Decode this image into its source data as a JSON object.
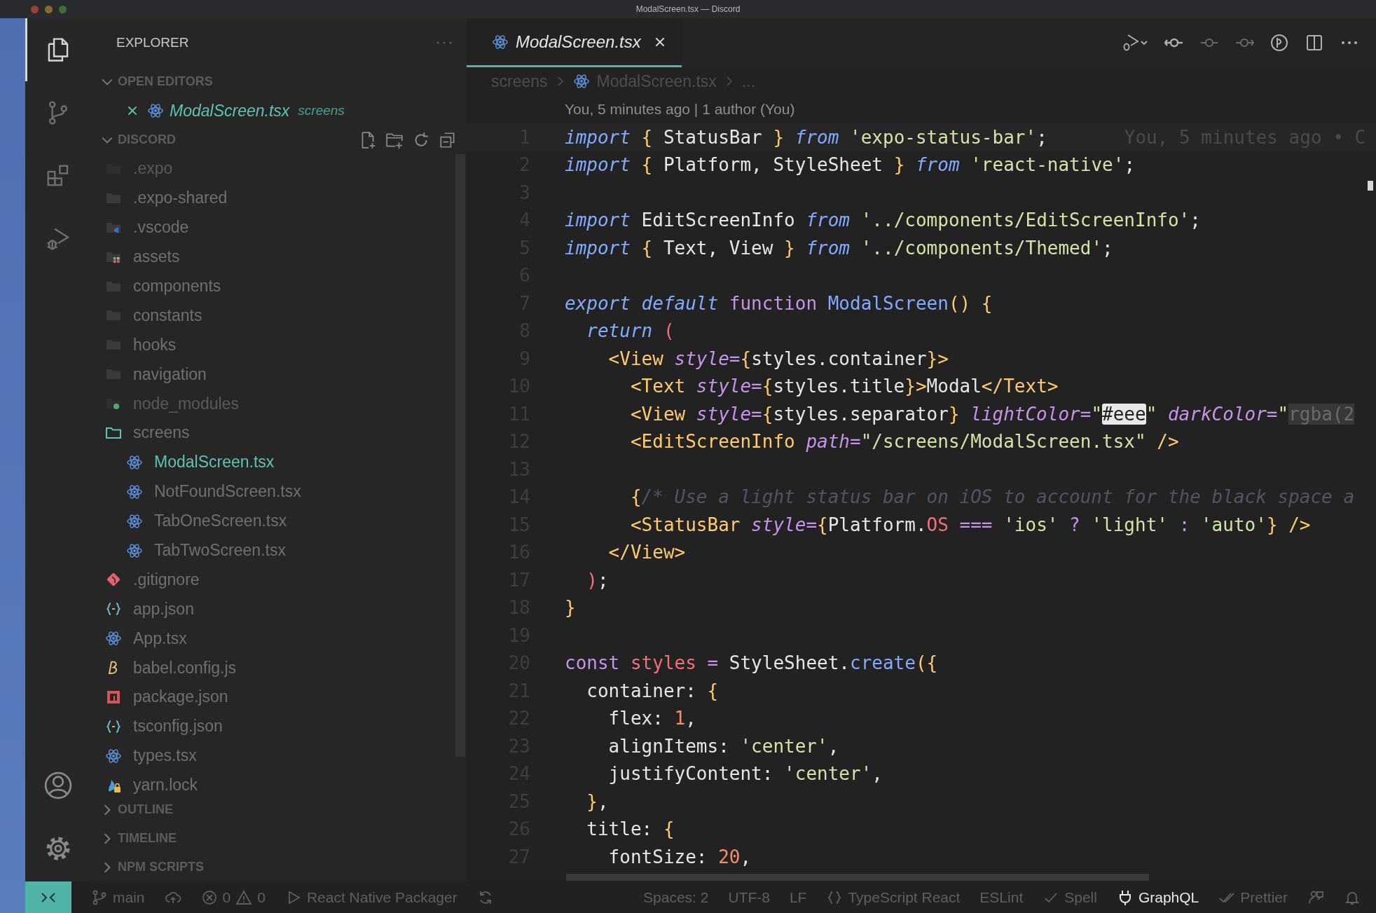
{
  "window": {
    "title": "ModalScreen.tsx — Discord"
  },
  "activity_bar": {
    "top": [
      {
        "kind": "explorer",
        "selected": true
      },
      {
        "kind": "source-control",
        "selected": false
      },
      {
        "kind": "extensions",
        "selected": false
      },
      {
        "kind": "run-debug",
        "selected": false
      }
    ],
    "bottom": [
      {
        "kind": "account"
      },
      {
        "kind": "settings"
      }
    ]
  },
  "sidebar": {
    "title": "EXPLORER",
    "sections": [
      {
        "title": "OPEN EDITORS",
        "expanded": true,
        "editors": [
          {
            "name": "ModalScreen.tsx",
            "folder": "screens",
            "kind": "react"
          }
        ]
      },
      {
        "title": "DISCORD",
        "expanded": true,
        "tree": [
          {
            "name": ".expo",
            "kind": "folder",
            "expanded": false,
            "dimmed": true,
            "selected": false
          },
          {
            "name": ".expo-shared",
            "kind": "folder",
            "expanded": false,
            "dimmed": false,
            "selected": false
          },
          {
            "name": ".vscode",
            "kind": "vscode-folder",
            "expanded": false,
            "dimmed": false,
            "selected": false
          },
          {
            "name": "assets",
            "kind": "assets-folder",
            "expanded": false,
            "dimmed": false,
            "selected": false
          },
          {
            "name": "components",
            "kind": "folder",
            "expanded": false,
            "dimmed": false,
            "selected": false
          },
          {
            "name": "constants",
            "kind": "folder",
            "expanded": false,
            "dimmed": false,
            "selected": false
          },
          {
            "name": "hooks",
            "kind": "folder",
            "expanded": false,
            "dimmed": false,
            "selected": false
          },
          {
            "name": "navigation",
            "kind": "folder",
            "expanded": false,
            "dimmed": false,
            "selected": false
          },
          {
            "name": "node_modules",
            "kind": "node-folder",
            "expanded": false,
            "dimmed": true,
            "selected": false
          },
          {
            "name": "screens",
            "kind": "folder",
            "expanded": true,
            "dimmed": false,
            "selected": false,
            "children": [
              {
                "name": "ModalScreen.tsx",
                "kind": "react",
                "dimmed": false,
                "selected": true
              },
              {
                "name": "NotFoundScreen.tsx",
                "kind": "react",
                "dimmed": false,
                "selected": false
              },
              {
                "name": "TabOneScreen.tsx",
                "kind": "react",
                "dimmed": false,
                "selected": false
              },
              {
                "name": "TabTwoScreen.tsx",
                "kind": "react",
                "dimmed": false,
                "selected": false
              }
            ]
          },
          {
            "name": ".gitignore",
            "kind": "git",
            "dimmed": false,
            "selected": false
          },
          {
            "name": "app.json",
            "kind": "json",
            "dimmed": false,
            "selected": false
          },
          {
            "name": "App.tsx",
            "kind": "react",
            "dimmed": false,
            "selected": false
          },
          {
            "name": "babel.config.js",
            "kind": "babel",
            "dimmed": false,
            "selected": false
          },
          {
            "name": "package.json",
            "kind": "npm",
            "dimmed": false,
            "selected": false
          },
          {
            "name": "tsconfig.json",
            "kind": "json",
            "dimmed": false,
            "selected": false
          },
          {
            "name": "types.tsx",
            "kind": "react",
            "dimmed": false,
            "selected": false
          },
          {
            "name": "yarn.lock",
            "kind": "yarn",
            "dimmed": false,
            "selected": false
          }
        ]
      },
      {
        "title": "OUTLINE",
        "expanded": false
      },
      {
        "title": "TIMELINE",
        "expanded": false
      },
      {
        "title": "NPM SCRIPTS",
        "expanded": false
      }
    ]
  },
  "editor": {
    "tabs": [
      {
        "name": "ModalScreen.tsx",
        "kind": "react",
        "selected": true
      }
    ],
    "breadcrumb": [
      {
        "text": "screens",
        "kind": "folder"
      },
      {
        "text": "ModalScreen.tsx",
        "kind": "react"
      },
      {
        "text": "...",
        "kind": "symbol"
      }
    ],
    "blame": "You, 5 minutes ago | 1 author (You)",
    "lines": [
      {
        "n": "1",
        "tokens": [
          {
            "kind": "kw",
            "t": "import "
          },
          {
            "kind": "pun",
            "t": "{ "
          },
          {
            "kind": "pl",
            "t": "StatusBar "
          },
          {
            "kind": "pun",
            "t": "} "
          },
          {
            "kind": "kw",
            "t": "from "
          },
          {
            "kind": "str",
            "t": "'expo-status-bar'"
          },
          {
            "kind": "pl",
            "t": ";"
          }
        ],
        "blame": "You, 5 minutes ago • C"
      },
      {
        "n": "2",
        "tokens": [
          {
            "kind": "kw",
            "t": "import "
          },
          {
            "kind": "pun",
            "t": "{ "
          },
          {
            "kind": "pl",
            "t": "Platform, StyleSheet "
          },
          {
            "kind": "pun",
            "t": "} "
          },
          {
            "kind": "kw",
            "t": "from "
          },
          {
            "kind": "str",
            "t": "'react-native'"
          },
          {
            "kind": "pl",
            "t": ";"
          }
        ]
      },
      {
        "n": "3"
      },
      {
        "n": "4",
        "tokens": [
          {
            "kind": "kw",
            "t": "import "
          },
          {
            "kind": "pl",
            "t": "EditScreenInfo "
          },
          {
            "kind": "kw",
            "t": "from "
          },
          {
            "kind": "str",
            "t": "'../components/EditScreenInfo'"
          },
          {
            "kind": "pl",
            "t": ";"
          }
        ]
      },
      {
        "n": "5",
        "tokens": [
          {
            "kind": "kw",
            "t": "import "
          },
          {
            "kind": "pun",
            "t": "{ "
          },
          {
            "kind": "pl",
            "t": "Text, View "
          },
          {
            "kind": "pun",
            "t": "} "
          },
          {
            "kind": "kw",
            "t": "from "
          },
          {
            "kind": "str",
            "t": "'../components/Themed'"
          },
          {
            "kind": "pl",
            "t": ";"
          }
        ]
      },
      {
        "n": "6"
      },
      {
        "n": "7",
        "tokens": [
          {
            "kind": "kw",
            "t": "export default "
          },
          {
            "kind": "ctl",
            "t": "function "
          },
          {
            "kind": "fn",
            "t": "ModalScreen"
          },
          {
            "kind": "pun",
            "t": "() {"
          }
        ]
      },
      {
        "n": "8",
        "tokens": [
          {
            "kind": "kw",
            "t": "  return "
          },
          {
            "kind": "par",
            "t": "("
          }
        ]
      },
      {
        "n": "9",
        "tokens": [
          {
            "kind": "tag",
            "t": "    <View "
          },
          {
            "kind": "attr",
            "t": "style="
          },
          {
            "kind": "pun",
            "t": "{"
          },
          {
            "kind": "pl",
            "t": "styles.container"
          },
          {
            "kind": "pun",
            "t": "}"
          },
          {
            "kind": "tag",
            "t": ">"
          }
        ]
      },
      {
        "n": "10",
        "tokens": [
          {
            "kind": "tag",
            "t": "      <Text "
          },
          {
            "kind": "attr",
            "t": "style="
          },
          {
            "kind": "pun",
            "t": "{"
          },
          {
            "kind": "pl",
            "t": "styles.title"
          },
          {
            "kind": "pun",
            "t": "}"
          },
          {
            "kind": "tag",
            "t": ">"
          },
          {
            "kind": "pl",
            "t": "Modal"
          },
          {
            "kind": "tag",
            "t": "</Text>"
          }
        ]
      },
      {
        "n": "11",
        "tokens": [
          {
            "kind": "tag",
            "t": "      <View "
          },
          {
            "kind": "attr",
            "t": "style="
          },
          {
            "kind": "pun",
            "t": "{"
          },
          {
            "kind": "pl",
            "t": "styles.separator"
          },
          {
            "kind": "pun",
            "t": "} "
          },
          {
            "kind": "attr",
            "t": "lightColor="
          },
          {
            "kind": "str",
            "t": "\""
          },
          {
            "kind": "hl",
            "t": "#eee"
          },
          {
            "kind": "str",
            "t": "\" "
          },
          {
            "kind": "attr",
            "t": "darkColor="
          },
          {
            "kind": "str",
            "t": "\""
          },
          {
            "kind": "hld",
            "t": "rgba(2"
          }
        ]
      },
      {
        "n": "12",
        "tokens": [
          {
            "kind": "tag",
            "t": "      <EditScreenInfo "
          },
          {
            "kind": "attr",
            "t": "path="
          },
          {
            "kind": "str",
            "t": "\"/screens/ModalScreen.tsx\" "
          },
          {
            "kind": "tag",
            "t": "/>"
          }
        ]
      },
      {
        "n": "13"
      },
      {
        "n": "14",
        "tokens": [
          {
            "kind": "pun",
            "t": "      {"
          },
          {
            "kind": "cm",
            "t": "/* Use a light status bar on iOS to account for the black space a"
          }
        ]
      },
      {
        "n": "15",
        "tokens": [
          {
            "kind": "tag",
            "t": "      <StatusBar "
          },
          {
            "kind": "attr",
            "t": "style="
          },
          {
            "kind": "pun",
            "t": "{"
          },
          {
            "kind": "pl",
            "t": "Platform."
          },
          {
            "kind": "var",
            "t": "OS "
          },
          {
            "kind": "op",
            "t": "=== "
          },
          {
            "kind": "str",
            "t": "'ios' "
          },
          {
            "kind": "op",
            "t": "? "
          },
          {
            "kind": "str",
            "t": "'light' "
          },
          {
            "kind": "op",
            "t": ": "
          },
          {
            "kind": "str",
            "t": "'auto'"
          },
          {
            "kind": "pun",
            "t": "} "
          },
          {
            "kind": "tag",
            "t": "/>"
          }
        ]
      },
      {
        "n": "16",
        "tokens": [
          {
            "kind": "tag",
            "t": "    </View>"
          }
        ]
      },
      {
        "n": "17",
        "tokens": [
          {
            "kind": "par",
            "t": "  )"
          },
          {
            "kind": "pl",
            "t": ";"
          }
        ]
      },
      {
        "n": "18",
        "tokens": [
          {
            "kind": "pun",
            "t": "}"
          }
        ]
      },
      {
        "n": "19"
      },
      {
        "n": "20",
        "tokens": [
          {
            "kind": "ctl",
            "t": "const "
          },
          {
            "kind": "var",
            "t": "styles "
          },
          {
            "kind": "op",
            "t": "= "
          },
          {
            "kind": "pl",
            "t": "StyleSheet."
          },
          {
            "kind": "fn",
            "t": "create"
          },
          {
            "kind": "pun",
            "t": "({"
          }
        ]
      },
      {
        "n": "21",
        "tokens": [
          {
            "kind": "pl",
            "t": "  container: "
          },
          {
            "kind": "pun",
            "t": "{"
          }
        ]
      },
      {
        "n": "22",
        "tokens": [
          {
            "kind": "pl",
            "t": "    flex: "
          },
          {
            "kind": "num",
            "t": "1"
          },
          {
            "kind": "pl",
            "t": ","
          }
        ]
      },
      {
        "n": "23",
        "tokens": [
          {
            "kind": "pl",
            "t": "    alignItems: "
          },
          {
            "kind": "str",
            "t": "'center'"
          },
          {
            "kind": "pl",
            "t": ","
          }
        ]
      },
      {
        "n": "24",
        "tokens": [
          {
            "kind": "pl",
            "t": "    justifyContent: "
          },
          {
            "kind": "str",
            "t": "'center'"
          },
          {
            "kind": "pl",
            "t": ","
          }
        ]
      },
      {
        "n": "25",
        "tokens": [
          {
            "kind": "pun",
            "t": "  }"
          },
          {
            "kind": "pl",
            "t": ","
          }
        ]
      },
      {
        "n": "26",
        "tokens": [
          {
            "kind": "pl",
            "t": "  title: "
          },
          {
            "kind": "pun",
            "t": "{"
          }
        ]
      },
      {
        "n": "27",
        "tokens": [
          {
            "kind": "pl",
            "t": "    fontSize: "
          },
          {
            "kind": "num",
            "t": "20"
          },
          {
            "kind": "pl",
            "t": ","
          }
        ]
      }
    ]
  },
  "status_bar": {
    "left": [
      {
        "kind": "remote"
      },
      {
        "kind": "branch",
        "text": "main"
      },
      {
        "kind": "sync"
      },
      {
        "kind": "problems",
        "errors": "0",
        "warnings": "0"
      },
      {
        "kind": "run",
        "text": "React Native Packager"
      },
      {
        "kind": "refresh"
      }
    ],
    "right": [
      {
        "kind": "plain",
        "text": "Spaces: 2",
        "bright": false
      },
      {
        "kind": "plain",
        "text": "UTF-8",
        "bright": false
      },
      {
        "kind": "plain",
        "text": "LF",
        "bright": false
      },
      {
        "kind": "braces",
        "text": "TypeScript React",
        "bright": false
      },
      {
        "kind": "plain",
        "text": "ESLint",
        "bright": false
      },
      {
        "kind": "check",
        "text": "Spell",
        "bright": false
      },
      {
        "kind": "plug",
        "text": "GraphQL",
        "bright": true
      },
      {
        "kind": "double-check",
        "text": "Prettier",
        "bright": false
      },
      {
        "kind": "feedback"
      },
      {
        "kind": "bell"
      }
    ]
  }
}
